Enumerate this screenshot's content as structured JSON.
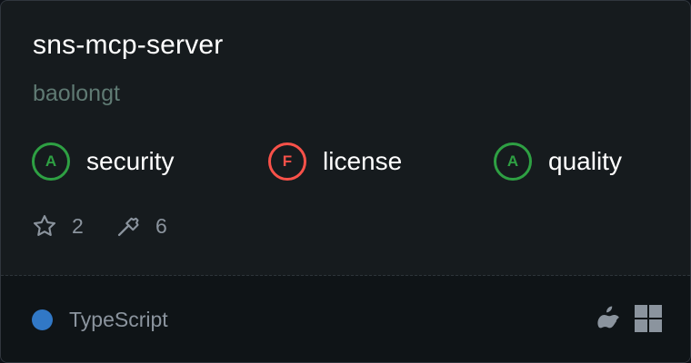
{
  "server": {
    "name": "sns-mcp-server",
    "author": "baolongt"
  },
  "scores": [
    {
      "grade": "A",
      "label": "security",
      "status_color": "#2ea043"
    },
    {
      "grade": "F",
      "label": "license",
      "status_color": "#f85149"
    },
    {
      "grade": "A",
      "label": "quality",
      "status_color": "#2ea043"
    }
  ],
  "stats": {
    "stars": "2",
    "tools": "6",
    "star_icon": "star-icon",
    "tools_icon": "hammer-icon"
  },
  "language": {
    "name": "TypeScript",
    "color": "#3178c6"
  },
  "platforms": [
    "apple-icon",
    "windows-icon"
  ]
}
